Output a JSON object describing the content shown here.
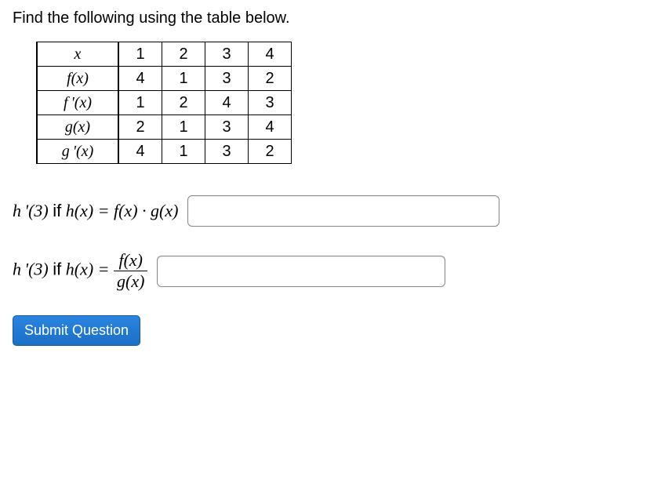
{
  "instruction": "Find the following using the table below.",
  "table": {
    "rows": [
      {
        "label": "x",
        "c1": "1",
        "c2": "2",
        "c3": "3",
        "c4": "4"
      },
      {
        "label": "f(x)",
        "c1": "4",
        "c2": "1",
        "c3": "3",
        "c4": "2"
      },
      {
        "label": "f '(x)",
        "c1": "1",
        "c2": "2",
        "c3": "4",
        "c4": "3"
      },
      {
        "label": "g(x)",
        "c1": "2",
        "c2": "1",
        "c3": "3",
        "c4": "4"
      },
      {
        "label": "g '(x)",
        "c1": "4",
        "c2": "1",
        "c3": "3",
        "c4": "2"
      }
    ]
  },
  "questions": {
    "q1": {
      "prefix": "h '(3)",
      "if_text": "if",
      "hx_eq": "h(x) =",
      "rhs": "f(x) · g(x)",
      "value": ""
    },
    "q2": {
      "prefix": "h '(3)",
      "if_text": "if",
      "hx_eq": "h(x) =",
      "frac_num": "f(x)",
      "frac_den": "g(x)",
      "value": ""
    }
  },
  "submit_label": "Submit Question"
}
